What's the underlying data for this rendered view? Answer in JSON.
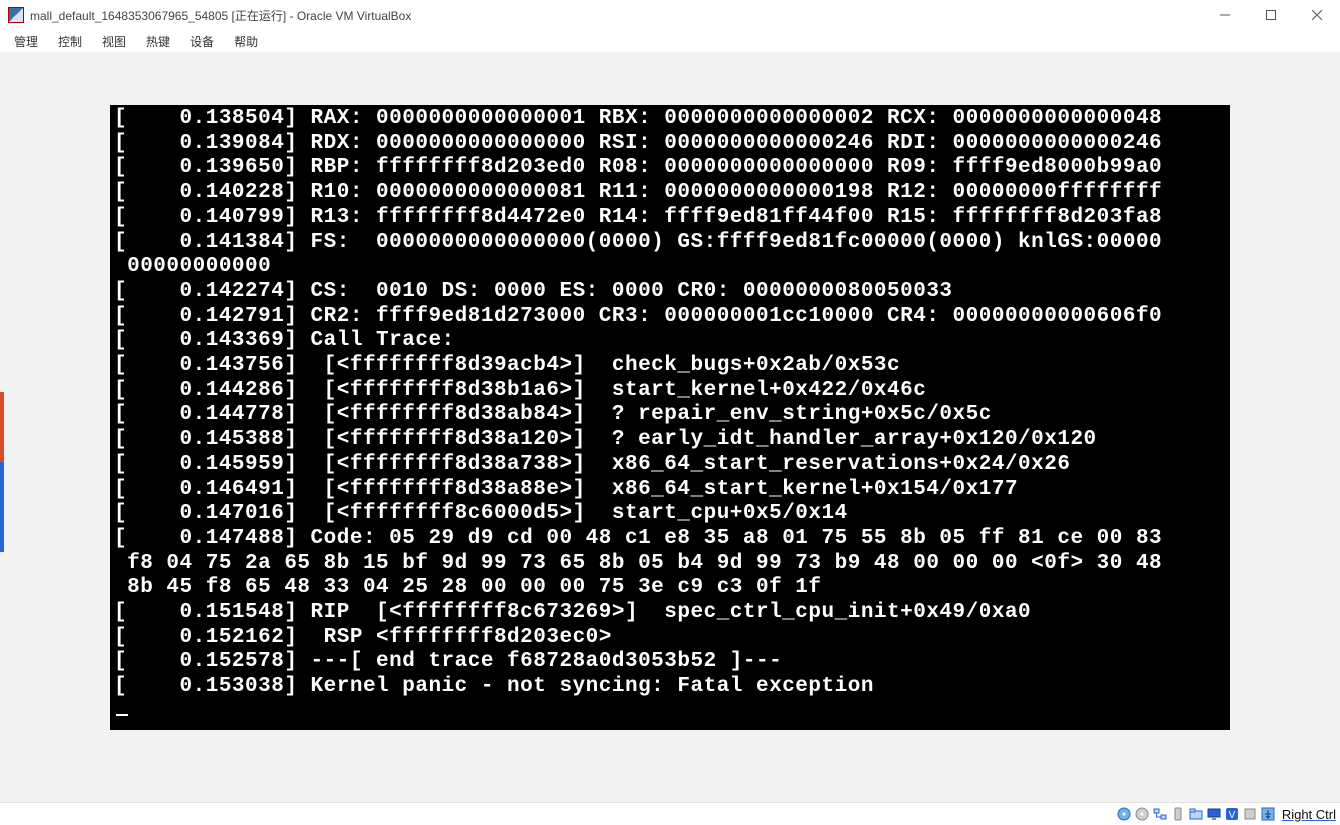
{
  "title": "mall_default_1648353067965_54805 [正在运行] - Oracle VM VirtualBox",
  "menubar": [
    "管理",
    "控制",
    "视图",
    "热键",
    "设备",
    "帮助"
  ],
  "console_lines": [
    "[    0.138504] RAX: 0000000000000001 RBX: 0000000000000002 RCX: 0000000000000048",
    "[    0.139084] RDX: 0000000000000000 RSI: 0000000000000246 RDI: 0000000000000246",
    "[    0.139650] RBP: ffffffff8d203ed0 R08: 0000000000000000 R09: ffff9ed8000b99a0",
    "[    0.140228] R10: 0000000000000081 R11: 0000000000000198 R12: 00000000ffffffff",
    "[    0.140799] R13: ffffffff8d4472e0 R14: ffff9ed81ff44f00 R15: ffffffff8d203fa8",
    "[    0.141384] FS:  0000000000000000(0000) GS:ffff9ed81fc00000(0000) knlGS:0000000000000000",
    "[    0.142274] CS:  0010 DS: 0000 ES: 0000 CR0: 0000000080050033",
    "[    0.142791] CR2: ffff9ed81d273000 CR3: 000000001cc10000 CR4: 00000000000606f0",
    "[    0.143369] Call Trace:",
    "[    0.143756]  [<ffffffff8d39acb4>]  check_bugs+0x2ab/0x53c",
    "[    0.144286]  [<ffffffff8d38b1a6>]  start_kernel+0x422/0x46c",
    "[    0.144778]  [<ffffffff8d38ab84>]  ? repair_env_string+0x5c/0x5c",
    "[    0.145388]  [<ffffffff8d38a120>]  ? early_idt_handler_array+0x120/0x120",
    "[    0.145959]  [<ffffffff8d38a738>]  x86_64_start_reservations+0x24/0x26",
    "[    0.146491]  [<ffffffff8d38a88e>]  x86_64_start_kernel+0x154/0x177",
    "[    0.147016]  [<ffffffff8c6000d5>]  start_cpu+0x5/0x14",
    "[    0.147488] Code: 05 29 d9 cd 00 48 c1 e8 35 a8 01 75 55 8b 05 ff 81 ce 00 83 f8 04 75 2a 65 8b 15 bf 9d 99 73 65 8b 05 b4 9d 99 73 b9 48 00 00 00 <0f> 30 48 8b 45 f8 65 48 33 04 25 28 00 00 00 75 3e c9 c3 0f 1f",
    "[    0.151548] RIP  [<ffffffff8c673269>]  spec_ctrl_cpu_init+0x49/0xa0",
    "[    0.152162]  RSP <ffffffff8d203ec0>",
    "[    0.152578] ---[ end trace f68728a0d3053b52 ]---",
    "[    0.153038] Kernel panic - not syncing: Fatal exception"
  ],
  "status_icons": [
    "harddisk-icon",
    "optical-disk-icon",
    "network-icon",
    "usb-icon",
    "shared-folder-icon",
    "display-icon",
    "recording-icon",
    "clipboard-icon",
    "mouse-capture-icon"
  ],
  "hostkey": "Right Ctrl"
}
